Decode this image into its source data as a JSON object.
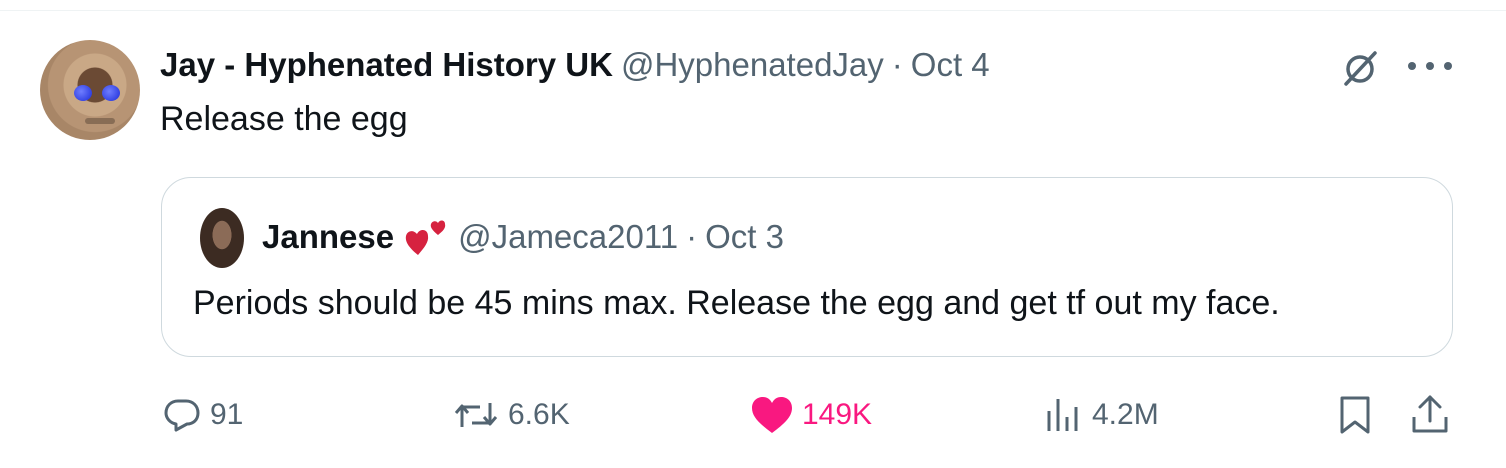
{
  "tweet": {
    "author_name": "Jay - Hyphenated History UK",
    "handle": "@HyphenatedJay",
    "separator": "·",
    "date": "Oct 4",
    "text": "Release the egg"
  },
  "quote": {
    "author_name": "Jannese",
    "handle": "@Jameca2011",
    "separator": "·",
    "date": "Oct 3",
    "text": "Periods should be 45 mins max. Release the egg and get tf out my face."
  },
  "actions": {
    "replies": "91",
    "retweets": "6.6K",
    "likes": "149K",
    "views": "4.2M"
  },
  "icons": [
    "grok-icon",
    "more-icon",
    "reply-icon",
    "retweet-icon",
    "heart-icon",
    "views-icon",
    "bookmark-icon",
    "share-icon",
    "two-hearts-icon"
  ],
  "colors": {
    "text": "#0f1419",
    "secondary": "#536471",
    "like_active": "#f91880",
    "border": "#cfd9de"
  }
}
